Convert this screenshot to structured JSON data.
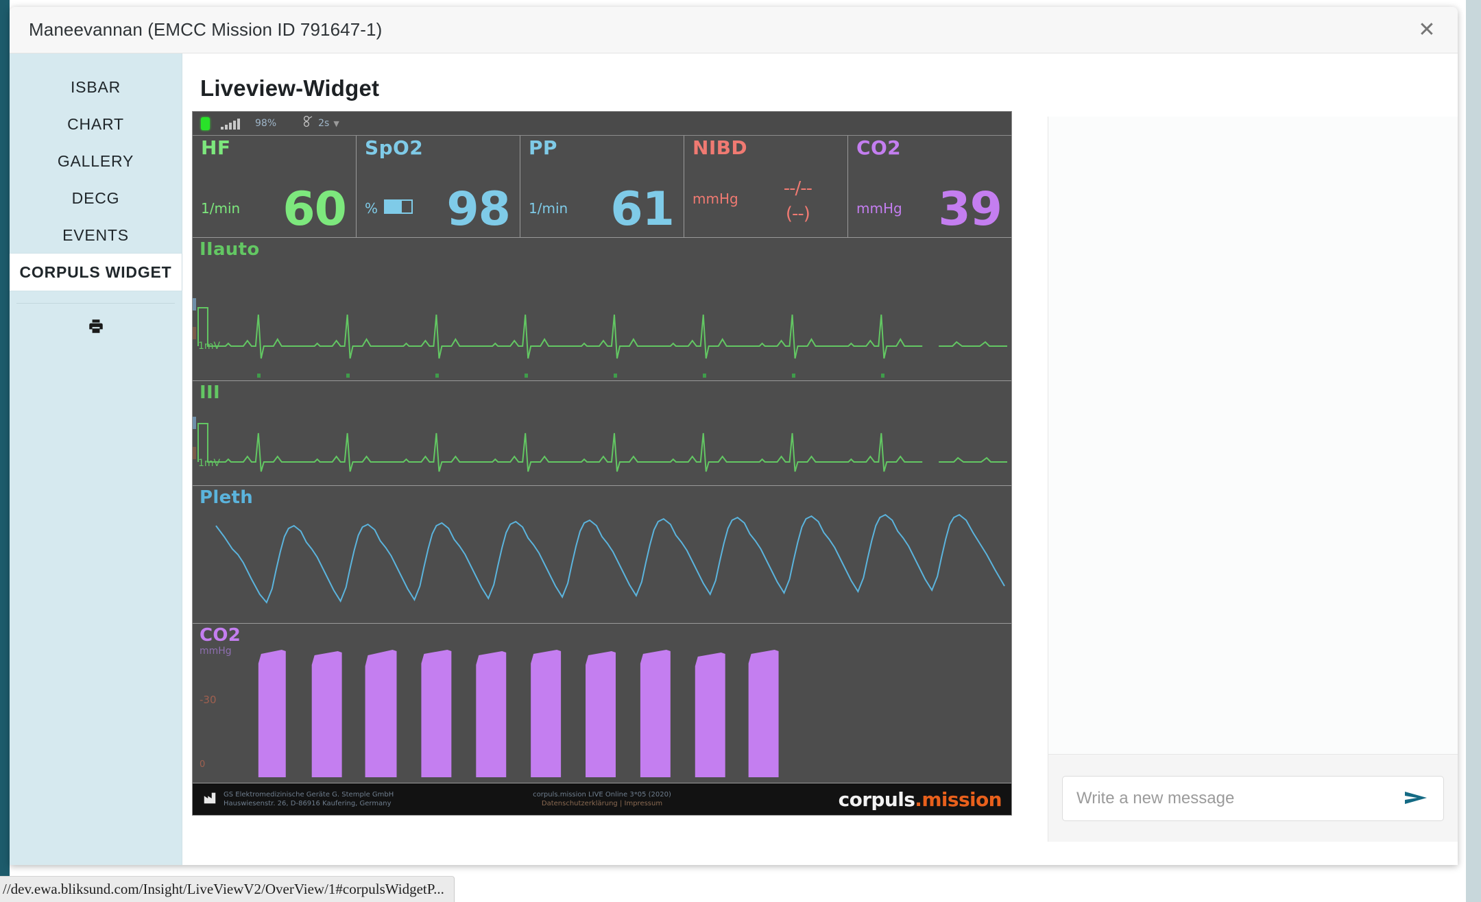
{
  "window": {
    "title": "Maneevannan (EMCC Mission ID 791647-1)",
    "close_label": "✕"
  },
  "sidebar": {
    "items": [
      {
        "label": "ISBAR",
        "active": false
      },
      {
        "label": "CHART",
        "active": false
      },
      {
        "label": "GALLERY",
        "active": false
      },
      {
        "label": "DECG",
        "active": false
      },
      {
        "label": "EVENTS",
        "active": false
      },
      {
        "label": "CORPULS WIDGET",
        "active": true
      }
    ],
    "print_icon": "printer-icon"
  },
  "main": {
    "heading": "Liveview-Widget"
  },
  "monitor": {
    "statusbar": {
      "battery_icon": "battery-full-icon",
      "signal_icon": "signal-bars-icon",
      "signal_percent": "98%",
      "speed_icon": "sweep-speed-icon",
      "speed_value": "2s",
      "caret_icon": "chevron-down-icon"
    },
    "vitals": [
      {
        "name": "HF",
        "unit": "1/min",
        "value": "60",
        "color": "#7de87d"
      },
      {
        "name": "SpO2",
        "unit": "%",
        "value": "98",
        "color": "#7fcbe8"
      },
      {
        "name": "PP",
        "unit": "1/min",
        "value": "61",
        "color": "#7fcbe8"
      },
      {
        "name": "NIBD",
        "unit": "mmHg",
        "value": "--/--\n(--)",
        "color": "#f07a72"
      },
      {
        "name": "CO2",
        "unit": "mmHg",
        "value": "39",
        "color": "#c47ef0"
      }
    ],
    "waves": [
      {
        "label": "IIauto",
        "sublabel": "1mV",
        "color": "#63c763",
        "type": "ecg"
      },
      {
        "label": "III",
        "sublabel": "1mV",
        "color": "#63c763",
        "type": "ecg"
      },
      {
        "label": "Pleth",
        "sublabel": "",
        "color": "#5bb4dd",
        "type": "pleth"
      },
      {
        "label": "CO2",
        "sublabel": "mmHg",
        "scale": "-30",
        "color": "#c47ef0",
        "type": "capno"
      }
    ],
    "footer": {
      "company_line1": "GS Elektromedizinische Geräte G. Stemple GmbH",
      "company_line2": "Hauswiesenstr. 26, D-86916 Kaufering, Germany",
      "center_line1": "corpuls.mission LIVE Online 3*05 (2020)",
      "center_line2_a": "Datenschutzerklärung",
      "center_line2_sep": "|",
      "center_line2_b": "Impressum",
      "logo_white": "corpuls",
      "logo_orange": ".mission",
      "factory_icon": "factory-icon"
    }
  },
  "chat": {
    "placeholder": "Write a new message",
    "send_icon": "send-arrow-icon",
    "input_value": ""
  },
  "browser": {
    "status_url": "//dev.ewa.bliksund.com/Insight/LiveViewV2/OverView/1#corpulsWidgetP..."
  },
  "colors": {
    "accent_teal": "#1d5b6b",
    "sidebar_bg": "#d6e9ef",
    "monitor_bg": "#4d4d4d",
    "brand_orange": "#e8601c"
  }
}
